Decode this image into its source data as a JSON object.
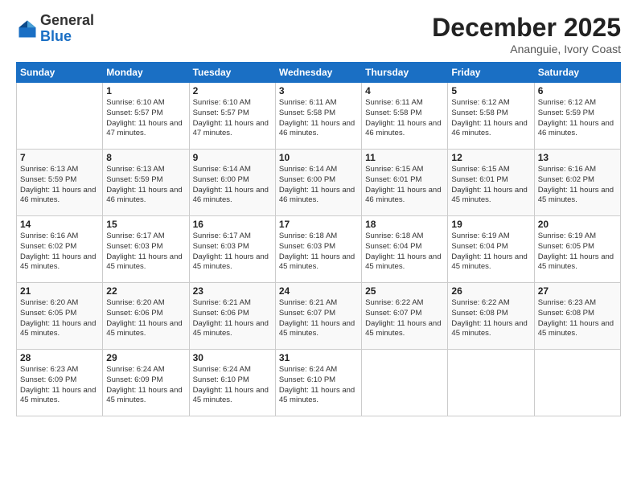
{
  "logo": {
    "general": "General",
    "blue": "Blue"
  },
  "header": {
    "month_year": "December 2025",
    "location": "Ananguie, Ivory Coast"
  },
  "weekdays": [
    "Sunday",
    "Monday",
    "Tuesday",
    "Wednesday",
    "Thursday",
    "Friday",
    "Saturday"
  ],
  "weeks": [
    [
      {
        "day": "",
        "sunrise": "",
        "sunset": "",
        "daylight": ""
      },
      {
        "day": "1",
        "sunrise": "Sunrise: 6:10 AM",
        "sunset": "Sunset: 5:57 PM",
        "daylight": "Daylight: 11 hours and 47 minutes."
      },
      {
        "day": "2",
        "sunrise": "Sunrise: 6:10 AM",
        "sunset": "Sunset: 5:57 PM",
        "daylight": "Daylight: 11 hours and 47 minutes."
      },
      {
        "day": "3",
        "sunrise": "Sunrise: 6:11 AM",
        "sunset": "Sunset: 5:58 PM",
        "daylight": "Daylight: 11 hours and 46 minutes."
      },
      {
        "day": "4",
        "sunrise": "Sunrise: 6:11 AM",
        "sunset": "Sunset: 5:58 PM",
        "daylight": "Daylight: 11 hours and 46 minutes."
      },
      {
        "day": "5",
        "sunrise": "Sunrise: 6:12 AM",
        "sunset": "Sunset: 5:58 PM",
        "daylight": "Daylight: 11 hours and 46 minutes."
      },
      {
        "day": "6",
        "sunrise": "Sunrise: 6:12 AM",
        "sunset": "Sunset: 5:59 PM",
        "daylight": "Daylight: 11 hours and 46 minutes."
      }
    ],
    [
      {
        "day": "7",
        "sunrise": "Sunrise: 6:13 AM",
        "sunset": "Sunset: 5:59 PM",
        "daylight": "Daylight: 11 hours and 46 minutes."
      },
      {
        "day": "8",
        "sunrise": "Sunrise: 6:13 AM",
        "sunset": "Sunset: 5:59 PM",
        "daylight": "Daylight: 11 hours and 46 minutes."
      },
      {
        "day": "9",
        "sunrise": "Sunrise: 6:14 AM",
        "sunset": "Sunset: 6:00 PM",
        "daylight": "Daylight: 11 hours and 46 minutes."
      },
      {
        "day": "10",
        "sunrise": "Sunrise: 6:14 AM",
        "sunset": "Sunset: 6:00 PM",
        "daylight": "Daylight: 11 hours and 46 minutes."
      },
      {
        "day": "11",
        "sunrise": "Sunrise: 6:15 AM",
        "sunset": "Sunset: 6:01 PM",
        "daylight": "Daylight: 11 hours and 46 minutes."
      },
      {
        "day": "12",
        "sunrise": "Sunrise: 6:15 AM",
        "sunset": "Sunset: 6:01 PM",
        "daylight": "Daylight: 11 hours and 45 minutes."
      },
      {
        "day": "13",
        "sunrise": "Sunrise: 6:16 AM",
        "sunset": "Sunset: 6:02 PM",
        "daylight": "Daylight: 11 hours and 45 minutes."
      }
    ],
    [
      {
        "day": "14",
        "sunrise": "Sunrise: 6:16 AM",
        "sunset": "Sunset: 6:02 PM",
        "daylight": "Daylight: 11 hours and 45 minutes."
      },
      {
        "day": "15",
        "sunrise": "Sunrise: 6:17 AM",
        "sunset": "Sunset: 6:03 PM",
        "daylight": "Daylight: 11 hours and 45 minutes."
      },
      {
        "day": "16",
        "sunrise": "Sunrise: 6:17 AM",
        "sunset": "Sunset: 6:03 PM",
        "daylight": "Daylight: 11 hours and 45 minutes."
      },
      {
        "day": "17",
        "sunrise": "Sunrise: 6:18 AM",
        "sunset": "Sunset: 6:03 PM",
        "daylight": "Daylight: 11 hours and 45 minutes."
      },
      {
        "day": "18",
        "sunrise": "Sunrise: 6:18 AM",
        "sunset": "Sunset: 6:04 PM",
        "daylight": "Daylight: 11 hours and 45 minutes."
      },
      {
        "day": "19",
        "sunrise": "Sunrise: 6:19 AM",
        "sunset": "Sunset: 6:04 PM",
        "daylight": "Daylight: 11 hours and 45 minutes."
      },
      {
        "day": "20",
        "sunrise": "Sunrise: 6:19 AM",
        "sunset": "Sunset: 6:05 PM",
        "daylight": "Daylight: 11 hours and 45 minutes."
      }
    ],
    [
      {
        "day": "21",
        "sunrise": "Sunrise: 6:20 AM",
        "sunset": "Sunset: 6:05 PM",
        "daylight": "Daylight: 11 hours and 45 minutes."
      },
      {
        "day": "22",
        "sunrise": "Sunrise: 6:20 AM",
        "sunset": "Sunset: 6:06 PM",
        "daylight": "Daylight: 11 hours and 45 minutes."
      },
      {
        "day": "23",
        "sunrise": "Sunrise: 6:21 AM",
        "sunset": "Sunset: 6:06 PM",
        "daylight": "Daylight: 11 hours and 45 minutes."
      },
      {
        "day": "24",
        "sunrise": "Sunrise: 6:21 AM",
        "sunset": "Sunset: 6:07 PM",
        "daylight": "Daylight: 11 hours and 45 minutes."
      },
      {
        "day": "25",
        "sunrise": "Sunrise: 6:22 AM",
        "sunset": "Sunset: 6:07 PM",
        "daylight": "Daylight: 11 hours and 45 minutes."
      },
      {
        "day": "26",
        "sunrise": "Sunrise: 6:22 AM",
        "sunset": "Sunset: 6:08 PM",
        "daylight": "Daylight: 11 hours and 45 minutes."
      },
      {
        "day": "27",
        "sunrise": "Sunrise: 6:23 AM",
        "sunset": "Sunset: 6:08 PM",
        "daylight": "Daylight: 11 hours and 45 minutes."
      }
    ],
    [
      {
        "day": "28",
        "sunrise": "Sunrise: 6:23 AM",
        "sunset": "Sunset: 6:09 PM",
        "daylight": "Daylight: 11 hours and 45 minutes."
      },
      {
        "day": "29",
        "sunrise": "Sunrise: 6:24 AM",
        "sunset": "Sunset: 6:09 PM",
        "daylight": "Daylight: 11 hours and 45 minutes."
      },
      {
        "day": "30",
        "sunrise": "Sunrise: 6:24 AM",
        "sunset": "Sunset: 6:10 PM",
        "daylight": "Daylight: 11 hours and 45 minutes."
      },
      {
        "day": "31",
        "sunrise": "Sunrise: 6:24 AM",
        "sunset": "Sunset: 6:10 PM",
        "daylight": "Daylight: 11 hours and 45 minutes."
      },
      {
        "day": "",
        "sunrise": "",
        "sunset": "",
        "daylight": ""
      },
      {
        "day": "",
        "sunrise": "",
        "sunset": "",
        "daylight": ""
      },
      {
        "day": "",
        "sunrise": "",
        "sunset": "",
        "daylight": ""
      }
    ]
  ]
}
